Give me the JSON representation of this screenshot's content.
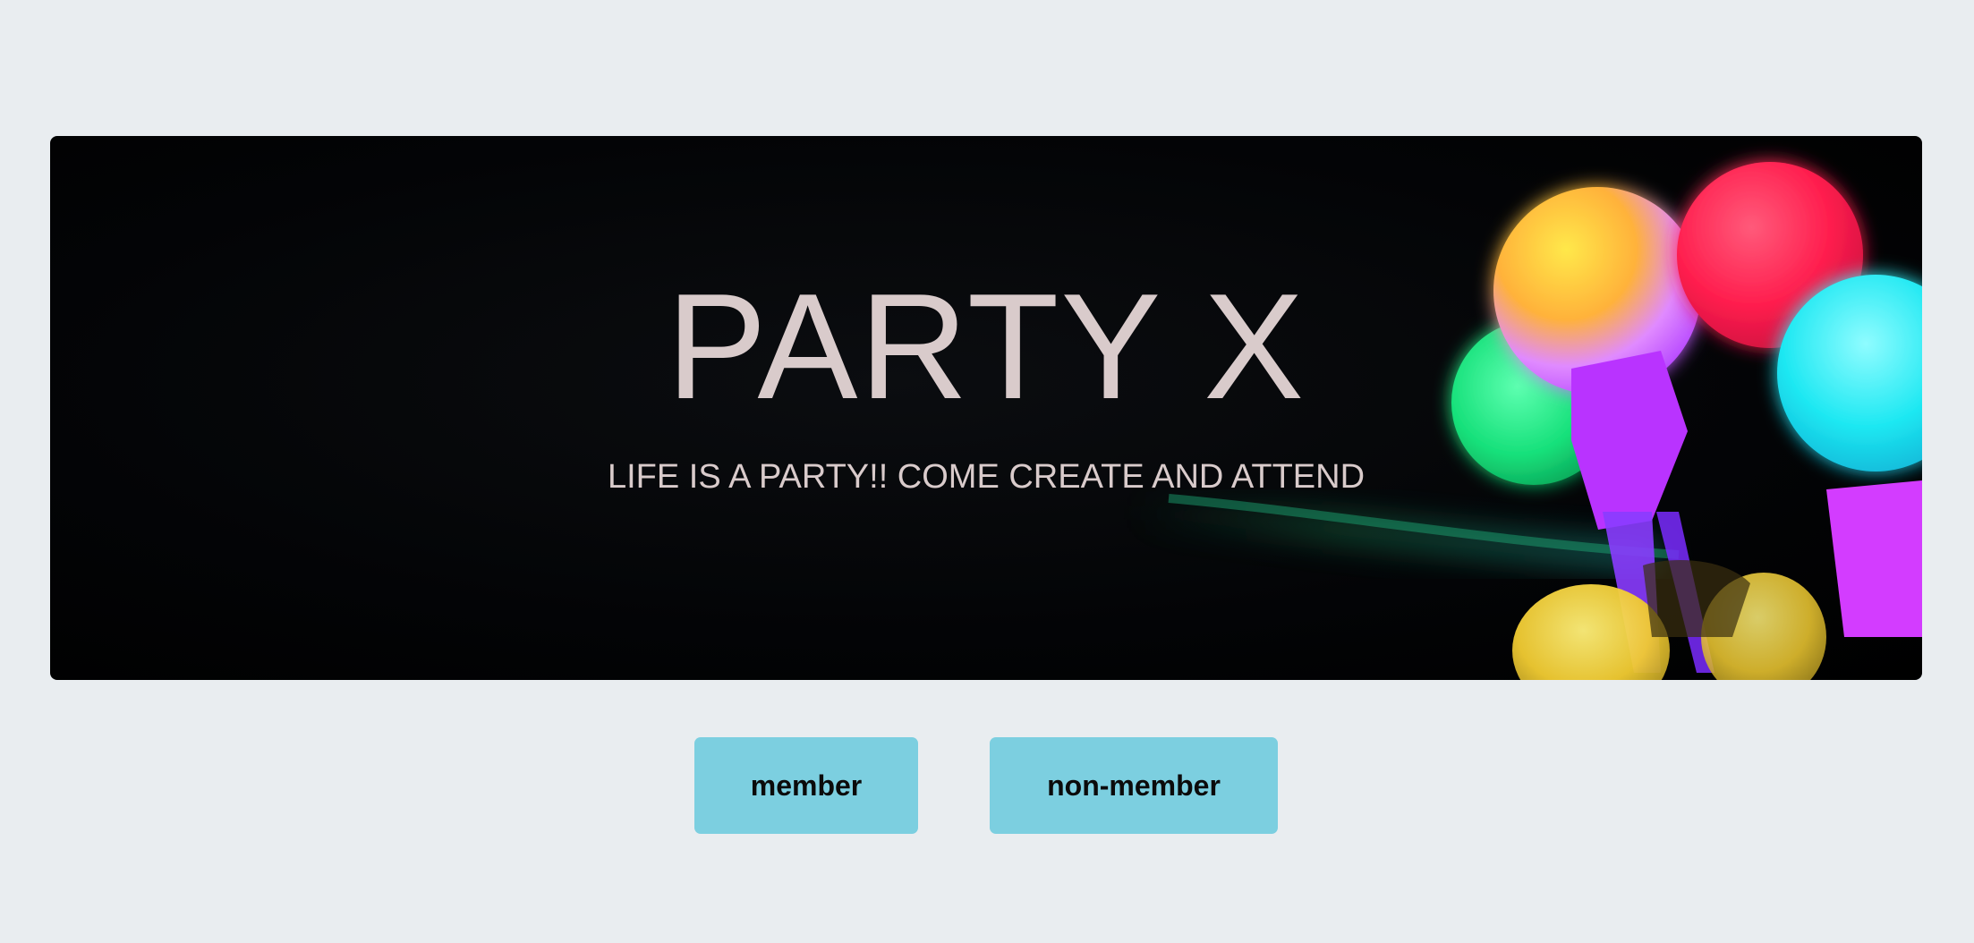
{
  "hero": {
    "title": "PARTY X",
    "tagline": "LIFE IS A PARTY!! COME CREATE AND ATTEND"
  },
  "buttons": {
    "member_label": "member",
    "nonmember_label": "non-member"
  },
  "colors": {
    "page_background": "#e9edf0",
    "hero_background": "#000000",
    "hero_text": "#d9cbcb",
    "button_background": "#7ccfe0",
    "button_text": "#0b0b0b"
  }
}
